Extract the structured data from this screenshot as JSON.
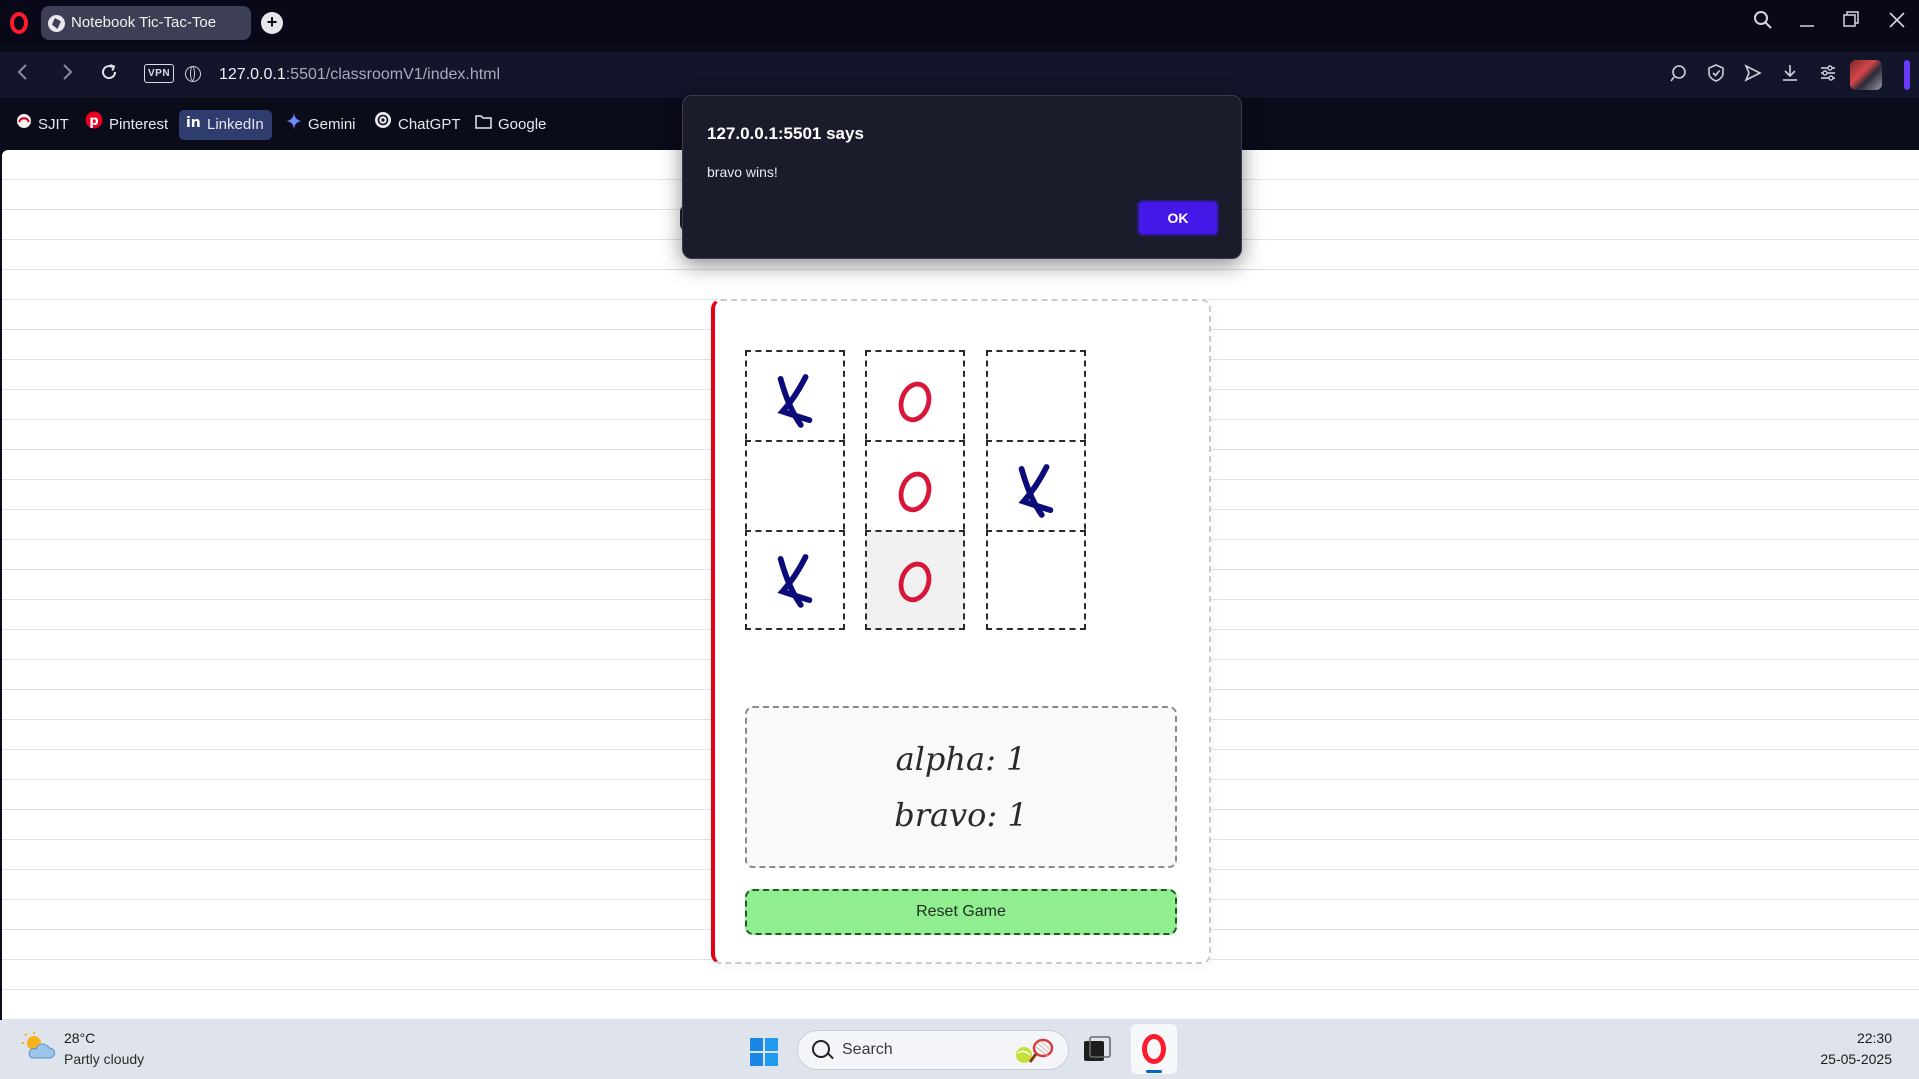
{
  "browser": {
    "tab_title": "Notebook Tic-Tac-Toe",
    "vpn_label": "VPN",
    "url_host": "127.0.0.1",
    "url_path": ":5501/classroomV1/index.html",
    "bookmarks": [
      {
        "label": "SJIT",
        "icon": "sjit-icon"
      },
      {
        "label": "Pinterest",
        "icon": "pinterest-icon"
      },
      {
        "label": "LinkedIn",
        "icon": "linkedin-icon"
      },
      {
        "label": "Gemini",
        "icon": "gemini-icon"
      },
      {
        "label": "ChatGPT",
        "icon": "chatgpt-icon"
      },
      {
        "label": "Google",
        "icon": "folder-icon"
      }
    ]
  },
  "dialog": {
    "title": "127.0.0.1:5501 says",
    "message": "bravo wins!",
    "ok_label": "OK"
  },
  "game": {
    "board": [
      "X",
      "O",
      "",
      "",
      "O",
      "X",
      "X",
      "O",
      ""
    ],
    "highlighted_cell": 7,
    "x_color": "#0b0b7a",
    "o_color": "#d8163a",
    "scores": [
      "alpha: 1",
      "bravo: 1"
    ],
    "reset_label": "Reset Game",
    "reset_color": "#90ee90",
    "card_accent": "#e60012"
  },
  "taskbar": {
    "temperature": "28°C",
    "weather": "Partly cloudy",
    "search_placeholder": "Search",
    "time": "22:30",
    "date": "25-05-2025"
  }
}
